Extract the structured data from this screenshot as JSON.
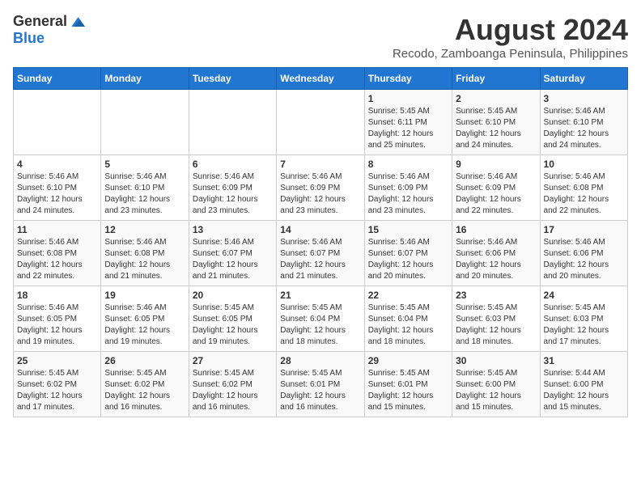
{
  "logo": {
    "general": "General",
    "blue": "Blue"
  },
  "title": "August 2024",
  "subtitle": "Recodo, Zamboanga Peninsula, Philippines",
  "days_header": [
    "Sunday",
    "Monday",
    "Tuesday",
    "Wednesday",
    "Thursday",
    "Friday",
    "Saturday"
  ],
  "weeks": [
    [
      {
        "day": "",
        "info": ""
      },
      {
        "day": "",
        "info": ""
      },
      {
        "day": "",
        "info": ""
      },
      {
        "day": "",
        "info": ""
      },
      {
        "day": "1",
        "info": "Sunrise: 5:45 AM\nSunset: 6:11 PM\nDaylight: 12 hours\nand 25 minutes."
      },
      {
        "day": "2",
        "info": "Sunrise: 5:45 AM\nSunset: 6:10 PM\nDaylight: 12 hours\nand 24 minutes."
      },
      {
        "day": "3",
        "info": "Sunrise: 5:46 AM\nSunset: 6:10 PM\nDaylight: 12 hours\nand 24 minutes."
      }
    ],
    [
      {
        "day": "4",
        "info": "Sunrise: 5:46 AM\nSunset: 6:10 PM\nDaylight: 12 hours\nand 24 minutes."
      },
      {
        "day": "5",
        "info": "Sunrise: 5:46 AM\nSunset: 6:10 PM\nDaylight: 12 hours\nand 23 minutes."
      },
      {
        "day": "6",
        "info": "Sunrise: 5:46 AM\nSunset: 6:09 PM\nDaylight: 12 hours\nand 23 minutes."
      },
      {
        "day": "7",
        "info": "Sunrise: 5:46 AM\nSunset: 6:09 PM\nDaylight: 12 hours\nand 23 minutes."
      },
      {
        "day": "8",
        "info": "Sunrise: 5:46 AM\nSunset: 6:09 PM\nDaylight: 12 hours\nand 23 minutes."
      },
      {
        "day": "9",
        "info": "Sunrise: 5:46 AM\nSunset: 6:09 PM\nDaylight: 12 hours\nand 22 minutes."
      },
      {
        "day": "10",
        "info": "Sunrise: 5:46 AM\nSunset: 6:08 PM\nDaylight: 12 hours\nand 22 minutes."
      }
    ],
    [
      {
        "day": "11",
        "info": "Sunrise: 5:46 AM\nSunset: 6:08 PM\nDaylight: 12 hours\nand 22 minutes."
      },
      {
        "day": "12",
        "info": "Sunrise: 5:46 AM\nSunset: 6:08 PM\nDaylight: 12 hours\nand 21 minutes."
      },
      {
        "day": "13",
        "info": "Sunrise: 5:46 AM\nSunset: 6:07 PM\nDaylight: 12 hours\nand 21 minutes."
      },
      {
        "day": "14",
        "info": "Sunrise: 5:46 AM\nSunset: 6:07 PM\nDaylight: 12 hours\nand 21 minutes."
      },
      {
        "day": "15",
        "info": "Sunrise: 5:46 AM\nSunset: 6:07 PM\nDaylight: 12 hours\nand 20 minutes."
      },
      {
        "day": "16",
        "info": "Sunrise: 5:46 AM\nSunset: 6:06 PM\nDaylight: 12 hours\nand 20 minutes."
      },
      {
        "day": "17",
        "info": "Sunrise: 5:46 AM\nSunset: 6:06 PM\nDaylight: 12 hours\nand 20 minutes."
      }
    ],
    [
      {
        "day": "18",
        "info": "Sunrise: 5:46 AM\nSunset: 6:05 PM\nDaylight: 12 hours\nand 19 minutes."
      },
      {
        "day": "19",
        "info": "Sunrise: 5:46 AM\nSunset: 6:05 PM\nDaylight: 12 hours\nand 19 minutes."
      },
      {
        "day": "20",
        "info": "Sunrise: 5:45 AM\nSunset: 6:05 PM\nDaylight: 12 hours\nand 19 minutes."
      },
      {
        "day": "21",
        "info": "Sunrise: 5:45 AM\nSunset: 6:04 PM\nDaylight: 12 hours\nand 18 minutes."
      },
      {
        "day": "22",
        "info": "Sunrise: 5:45 AM\nSunset: 6:04 PM\nDaylight: 12 hours\nand 18 minutes."
      },
      {
        "day": "23",
        "info": "Sunrise: 5:45 AM\nSunset: 6:03 PM\nDaylight: 12 hours\nand 18 minutes."
      },
      {
        "day": "24",
        "info": "Sunrise: 5:45 AM\nSunset: 6:03 PM\nDaylight: 12 hours\nand 17 minutes."
      }
    ],
    [
      {
        "day": "25",
        "info": "Sunrise: 5:45 AM\nSunset: 6:02 PM\nDaylight: 12 hours\nand 17 minutes."
      },
      {
        "day": "26",
        "info": "Sunrise: 5:45 AM\nSunset: 6:02 PM\nDaylight: 12 hours\nand 16 minutes."
      },
      {
        "day": "27",
        "info": "Sunrise: 5:45 AM\nSunset: 6:02 PM\nDaylight: 12 hours\nand 16 minutes."
      },
      {
        "day": "28",
        "info": "Sunrise: 5:45 AM\nSunset: 6:01 PM\nDaylight: 12 hours\nand 16 minutes."
      },
      {
        "day": "29",
        "info": "Sunrise: 5:45 AM\nSunset: 6:01 PM\nDaylight: 12 hours\nand 15 minutes."
      },
      {
        "day": "30",
        "info": "Sunrise: 5:45 AM\nSunset: 6:00 PM\nDaylight: 12 hours\nand 15 minutes."
      },
      {
        "day": "31",
        "info": "Sunrise: 5:44 AM\nSunset: 6:00 PM\nDaylight: 12 hours\nand 15 minutes."
      }
    ]
  ]
}
